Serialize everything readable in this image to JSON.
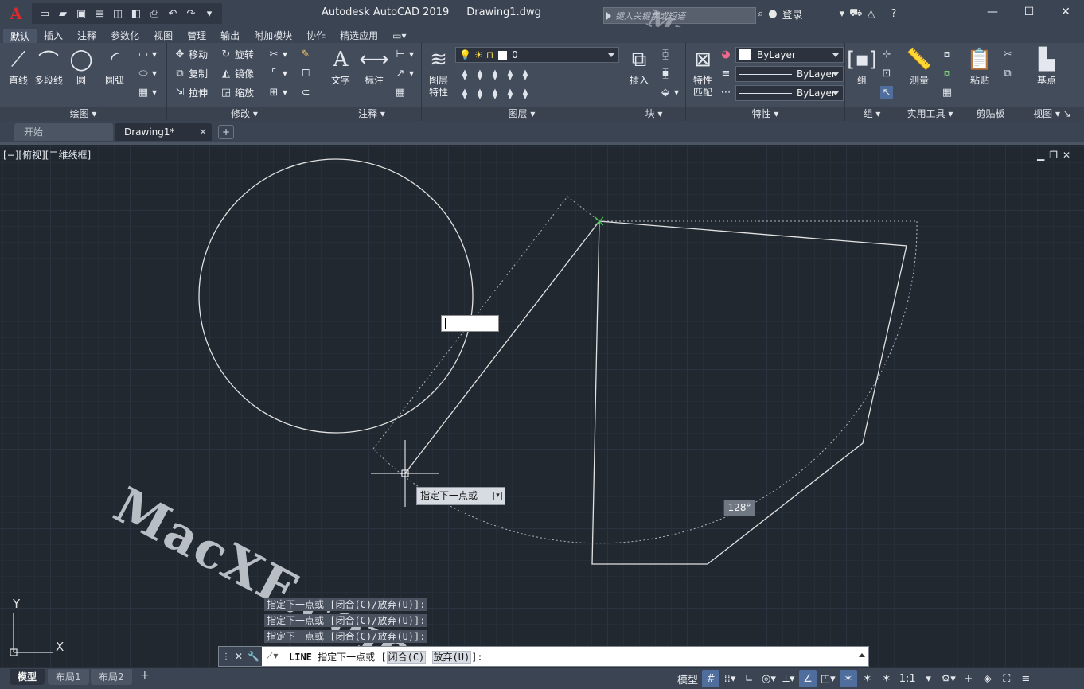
{
  "titlebar": {
    "logo": "A",
    "app_name": "Autodesk AutoCAD 2019",
    "file_name": "Drawing1.dwg",
    "search_placeholder": "键入关键字或短语",
    "login": "登录"
  },
  "ribbon_tabs": [
    "默认",
    "插入",
    "注释",
    "参数化",
    "视图",
    "管理",
    "输出",
    "附加模块",
    "协作",
    "精选应用"
  ],
  "ribbon": {
    "draw": {
      "title": "绘图",
      "line": "直线",
      "polyline": "多段线",
      "circle": "圆",
      "arc": "圆弧"
    },
    "modify": {
      "title": "修改",
      "move": "移动",
      "rotate": "旋转",
      "copy": "复制",
      "mirror": "镜像",
      "stretch": "拉伸",
      "scale": "缩放"
    },
    "annotation": {
      "title": "注释",
      "text": "文字",
      "dimension": "标注"
    },
    "layers": {
      "title": "图层",
      "layer_props": "图层\n特性",
      "current_layer": "0"
    },
    "block": {
      "title": "块",
      "insert": "插入"
    },
    "properties": {
      "title": "特性",
      "match": "特性\n匹配",
      "color": "ByLayer",
      "linetype": "ByLayer",
      "lineweight": "ByLayer"
    },
    "groups": {
      "title": "组",
      "group": "组"
    },
    "utilities": {
      "title": "实用工具",
      "measure": "测量"
    },
    "clipboard": {
      "title": "剪贴板",
      "paste": "粘贴"
    },
    "view": {
      "title": "视图",
      "base": "基点"
    }
  },
  "doc_tabs": [
    {
      "label": "开始"
    },
    {
      "label": "Drawing1*"
    }
  ],
  "viewport": {
    "label": "[−][俯视][二维线框]"
  },
  "dynamic_input": {
    "value": ""
  },
  "tooltip": {
    "text": "指定下一点或"
  },
  "angle_label": "128°",
  "watermark": "MacXF.com",
  "watermark_top": "MacXF.com",
  "ucs": {
    "x": "X",
    "y": "Y"
  },
  "command_history": [
    "指定下一点或 [闭合(C)/放弃(U)]:",
    "指定下一点或 [闭合(C)/放弃(U)]:",
    "指定下一点或 [闭合(C)/放弃(U)]:"
  ],
  "command_line": {
    "command": "LINE",
    "prompt": "指定下一点或 [",
    "option1": "闭合(C)",
    "option2": "放弃(U)",
    "suffix": "]:"
  },
  "layout_tabs": [
    "模型",
    "布局1",
    "布局2"
  ],
  "status": {
    "model": "模型",
    "scale": "1:1"
  },
  "colors": {
    "background": "#212830",
    "ribbon": "#434c5b",
    "titlebar": "#3b4453",
    "lines": "#e0e0e0",
    "accent": "#4f6e9d"
  }
}
